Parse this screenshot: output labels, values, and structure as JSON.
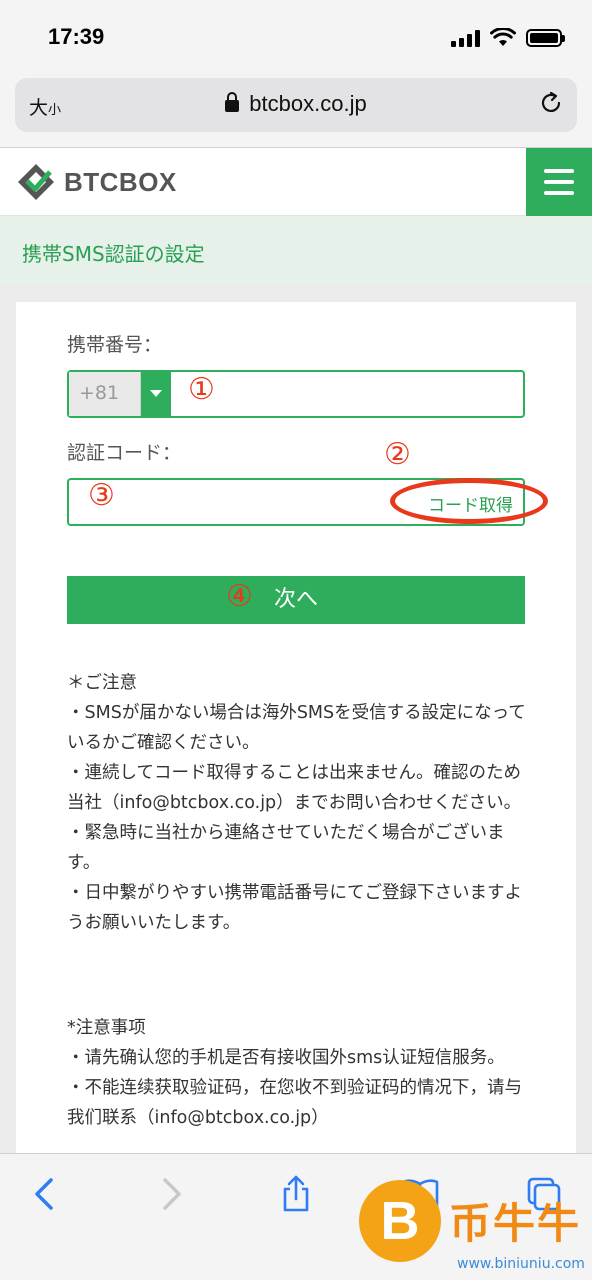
{
  "status_bar": {
    "time": "17:39"
  },
  "browser": {
    "text_size_label": "大",
    "text_size_small": "小",
    "url": "btcbox.co.jp",
    "reload_icon": "reload-icon"
  },
  "site": {
    "logo_text": "BTCBOX",
    "menu_icon": "hamburger-menu-icon"
  },
  "page": {
    "title": "携帯SMS認証の設定"
  },
  "form": {
    "phone_label": "携帯番号：",
    "country_code": "+81",
    "code_label": "認証コード：",
    "get_code_label": "コード取得",
    "next_label": "次へ"
  },
  "annotations": {
    "mark1": "①",
    "mark2": "②",
    "mark3": "③",
    "mark4": "④"
  },
  "notes_ja": [
    "＊ご注意",
    "・SMSが届かない場合は海外SMSを受信する設定になっているかご確認ください。",
    "・連続してコード取得することは出来ません。確認のため当社（info@btcbox.co.jp）までお問い合わせください。",
    "・緊急時に当社から連絡させていただく場合がございます。",
    "・日中繋がりやすい携帯電話番号にてご登録下さいますようお願いいたします。"
  ],
  "notes_zh": [
    "*注意事项",
    "・请先确认您的手机是否有接收国外sms认证短信服务。",
    "・不能连续获取验证码，在您收不到验证码的情况下，请与我们联系（info@btcbox.co.jp）"
  ],
  "watermark": {
    "coin": "B",
    "title": "币牛牛",
    "url": "www.biniuniu.com"
  },
  "colors": {
    "brand_green": "#2eae5c",
    "annotation_red": "#e8391a"
  }
}
